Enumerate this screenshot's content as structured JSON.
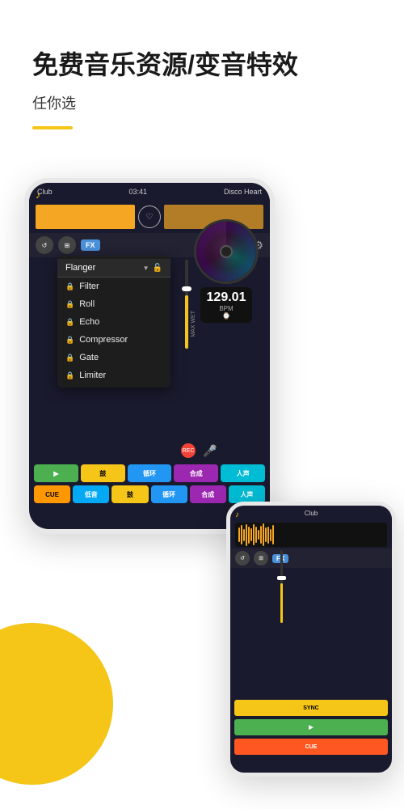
{
  "hero": {
    "title": "免费音乐资源/变音特效",
    "subtitle": "任你选"
  },
  "main_phone": {
    "track_left": "Club",
    "time": "03:41",
    "track_right": "Disco Heart",
    "fx_selected": "Flanger",
    "fx_items": [
      {
        "label": "Filter"
      },
      {
        "label": "Roll"
      },
      {
        "label": "Echo"
      },
      {
        "label": "Compressor"
      },
      {
        "label": "Gate"
      },
      {
        "label": "Limiter"
      }
    ],
    "bpm": "129.01",
    "bpm_label": "BPM",
    "max_wet": "MAX WET",
    "rec": "REC",
    "pads_row1": [
      "▶",
      "鼓",
      "循环",
      "合成",
      "人声"
    ],
    "pads_row2": [
      "CUE",
      "低音",
      "鼓",
      "循环",
      "合成",
      "人声"
    ]
  },
  "secondary_phone": {
    "track": "Club",
    "pads": [
      "SYNC",
      "▶",
      "CUE"
    ]
  },
  "colors": {
    "accent_yellow": "#f5c518",
    "app_bg": "#1a1a2e"
  }
}
